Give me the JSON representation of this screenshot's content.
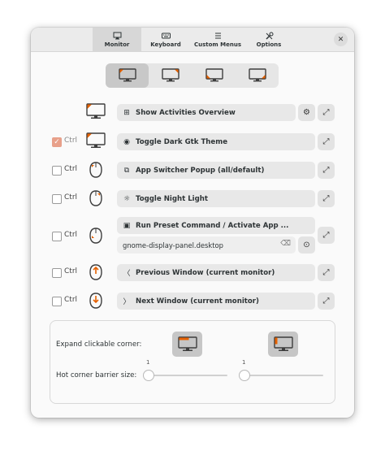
{
  "tabs": [
    {
      "label": "Monitor",
      "icon": "monitor-icon",
      "active": true
    },
    {
      "label": "Keyboard",
      "icon": "keyboard-icon",
      "active": false
    },
    {
      "label": "Custom Menus",
      "icon": "menu-icon",
      "active": false
    },
    {
      "label": "Options",
      "icon": "tools-icon",
      "active": false
    }
  ],
  "close_label": "✕",
  "monitor_corners": [
    "top-left",
    "top-right",
    "bottom-left",
    "bottom-right"
  ],
  "accent": "#e66100",
  "rows": [
    {
      "ctrl": "",
      "checked": false,
      "corner": "top-left",
      "action": "Show Activities Overview",
      "icon": "grid-icon"
    },
    {
      "ctrl": "Ctrl",
      "checked": true,
      "corner": "top-left",
      "action": "Toggle Dark Gtk Theme",
      "icon": "eye-icon"
    },
    {
      "ctrl": "Ctrl",
      "checked": false,
      "corner": "top-left",
      "action": "App Switcher Popup (all/default)",
      "icon": "window-switch-icon"
    },
    {
      "ctrl": "Ctrl",
      "checked": false,
      "corner": "top-right",
      "action": "Toggle Night Light",
      "icon": "sun-icon"
    },
    {
      "ctrl": "Ctrl",
      "checked": false,
      "corner": "bottom-left",
      "action": "Run Preset Command / Activate App ...",
      "icon": "terminal-icon",
      "command": "gnome-display-panel.desktop"
    },
    {
      "ctrl": "Ctrl",
      "checked": false,
      "corner": "up",
      "action": "Previous Window (current monitor)",
      "icon": "chevron-left-icon"
    },
    {
      "ctrl": "Ctrl",
      "checked": false,
      "corner": "down",
      "action": "Next Window (current monitor)",
      "icon": "chevron-right-icon"
    }
  ],
  "bottom": {
    "expand_label": "Expand clickable corner:",
    "barrier_label": "Hot corner barrier size:",
    "slider_left_value": "1",
    "slider_right_value": "1"
  }
}
